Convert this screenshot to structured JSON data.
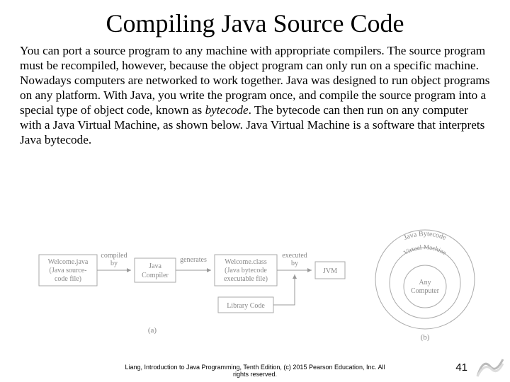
{
  "title": "Compiling Java Source Code",
  "body": {
    "p1a": "You can port a source program to any machine with appropriate compilers. The source program must be recompiled, however, because the object program can only run on a specific machine. Nowadays computers are networked to work together. Java was designed to run object programs on any platform. With Java, you write the program once, and compile the source program into a special type of object code, known as ",
    "p1_italic1": "bytecode",
    "p1b": ". The bytecode can then run on any computer with a Java Virtual Machine, as shown below. Java Virtual Machine is a software that interprets Java bytecode."
  },
  "diagram": {
    "box_source_l1": "Welcome.java",
    "box_source_l2": "(Java source-",
    "box_source_l3": "code file)",
    "arrow_compiled": "compiled",
    "arrow_by1": "by",
    "box_compiler_l1": "Java",
    "box_compiler_l2": "Compiler",
    "arrow_generates": "generates",
    "box_class_l1": "Welcome.class",
    "box_class_l2": "(Java bytecode",
    "box_class_l3": "executable file)",
    "arrow_executed": "executed",
    "arrow_by2": "by",
    "box_jvm": "JVM",
    "box_library": "Library Code",
    "label_a": "(a)",
    "ring_outer": "Java Bytecode",
    "ring_mid": "Virtual Machine",
    "ring_inner_l1": "Any",
    "ring_inner_l2": "Computer",
    "label_b": "(b)"
  },
  "footer": {
    "line1": "Liang, Introduction to Java Programming, Tenth Edition, (c) 2015 Pearson Education, Inc. All",
    "line2": "rights reserved."
  },
  "page_number": "41"
}
